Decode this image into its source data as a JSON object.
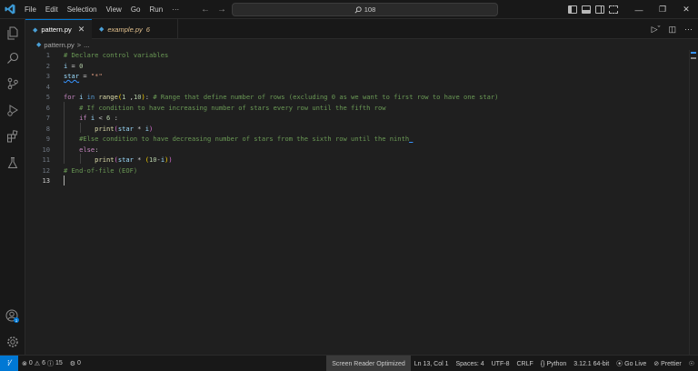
{
  "titlebar": {
    "menu": [
      "File",
      "Edit",
      "Selection",
      "View",
      "Go",
      "Run",
      "···"
    ],
    "search_text": "108"
  },
  "tabs": [
    {
      "label": "pattern.py",
      "active": true
    },
    {
      "label": "example.py",
      "badge": "6",
      "active": false
    }
  ],
  "breadcrumb": {
    "file": "pattern.py",
    "separator": ">",
    "rest": "..."
  },
  "editor": {
    "line_numbers": [
      "1",
      "2",
      "3",
      "4",
      "5",
      "6",
      "7",
      "8",
      "9",
      "10",
      "11",
      "12",
      "13"
    ],
    "current_line": 13
  },
  "statusbar": {
    "errors": "0",
    "warnings": "6",
    "info": "15",
    "ports": "0",
    "screen_reader": "Screen Reader Optimized",
    "position": "Ln 13, Col 1",
    "spaces": "Spaces: 4",
    "encoding": "UTF-8",
    "eol": "CRLF",
    "language": "Python",
    "interpreter": "3.12.1 64-bit",
    "go_live": "Go Live",
    "prettier": "Prettier"
  },
  "colors": {
    "accent": "#0078d4",
    "comment": "#6a9955",
    "keyword": "#c586c0",
    "string": "#ce9178",
    "number": "#b5cea8",
    "function": "#dcdcaa",
    "variable": "#9cdcfe"
  },
  "icons": [
    "vscode-logo-icon",
    "explorer-icon",
    "search-icon",
    "source-control-icon",
    "run-debug-icon",
    "extensions-icon",
    "testing-icon",
    "account-icon",
    "settings-gear-icon",
    "python-file-icon",
    "run-icon",
    "split-editor-icon",
    "more-icon",
    "remote-icon",
    "error-icon",
    "warning-icon",
    "info-icon",
    "ports-icon",
    "bell-icon"
  ]
}
